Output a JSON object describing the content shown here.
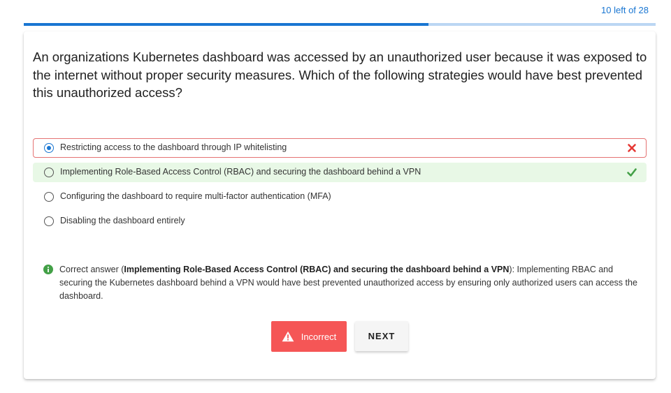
{
  "header": {
    "progress_label": "10 left of 28",
    "progress_fraction": 0.64
  },
  "question": {
    "text": "An organizations Kubernetes dashboard was accessed by an unauthorized user because it was exposed to the internet without proper security measures. Which of the following strategies would have best prevented this unauthorized access?"
  },
  "options": [
    {
      "label": "Restricting access to the dashboard through IP whitelisting",
      "selected": true,
      "state": "wrong"
    },
    {
      "label": "Implementing Role-Based Access Control (RBAC) and securing the dashboard behind a VPN",
      "selected": false,
      "state": "correct"
    },
    {
      "label": "Configuring the dashboard to require multi-factor authentication (MFA)",
      "selected": false,
      "state": "none"
    },
    {
      "label": "Disabling the dashboard entirely",
      "selected": false,
      "state": "none"
    }
  ],
  "explanation": {
    "prefix": "Correct answer (",
    "answer": "Implementing Role-Based Access Control (RBAC) and securing the dashboard behind a VPN",
    "suffix": "): Implementing RBAC and securing the Kubernetes dashboard behind a VPN would have best prevented unauthorized access by ensuring only authorized users can access the dashboard."
  },
  "buttons": {
    "incorrect_label": "Incorrect",
    "next_label": "NEXT"
  },
  "colors": {
    "accent": "#1976d2",
    "wrong": "#e53935",
    "correct": "#43a047",
    "incorrect_button": "#f55656"
  },
  "icons": {
    "wrong_mark": "close-icon",
    "correct_mark": "check-icon",
    "explanation": "info-icon",
    "incorrect_button": "warning-icon"
  }
}
